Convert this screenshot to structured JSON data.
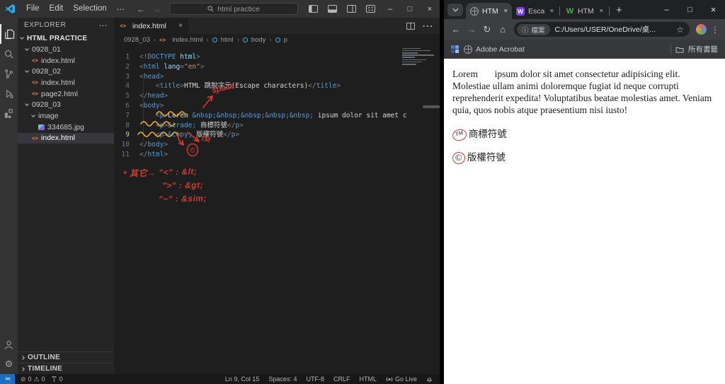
{
  "vscode": {
    "titlebar": {
      "menus": [
        "File",
        "Edit",
        "Selection",
        "⋯"
      ],
      "search_label": "html practice"
    },
    "explorer": {
      "header": "EXPLORER",
      "root": "HTML PRACTICE",
      "items": [
        {
          "label": "0928_01",
          "indent": 1,
          "chevron": true
        },
        {
          "label": "index.html",
          "indent": 2,
          "icon": "html"
        },
        {
          "label": "0928_02",
          "indent": 1,
          "chevron": true
        },
        {
          "label": "index.html",
          "indent": 2,
          "icon": "html"
        },
        {
          "label": "page2.html",
          "indent": 2,
          "icon": "html"
        },
        {
          "label": "0928_03",
          "indent": 1,
          "chevron": true
        },
        {
          "label": "image",
          "indent": 2,
          "chevron": true
        },
        {
          "label": "334685.jpg",
          "indent": 3,
          "icon": "img"
        },
        {
          "label": "index.html",
          "indent": 2,
          "icon": "html",
          "selected": true
        }
      ],
      "panels": [
        "OUTLINE",
        "TIMELINE"
      ]
    },
    "editor": {
      "tab": "index.html",
      "breadcrumb": [
        "0928_03",
        "index.html",
        "html",
        "body",
        "p"
      ],
      "lines": [
        {
          "n": 1,
          "tokens": [
            [
              "p",
              "<!"
            ],
            [
              "k",
              "DOCTYPE"
            ],
            [
              "a",
              " html"
            ],
            [
              "p",
              ">"
            ]
          ]
        },
        {
          "n": 2,
          "tokens": [
            [
              "p",
              "<"
            ],
            [
              "k",
              "html"
            ],
            [
              "a",
              " lang"
            ],
            [
              "p",
              "="
            ],
            [
              "s",
              "\"en\""
            ],
            [
              "p",
              ">"
            ]
          ]
        },
        {
          "n": 3,
          "tokens": [
            [
              "p",
              "<"
            ],
            [
              "k",
              "head"
            ],
            [
              "p",
              ">"
            ]
          ]
        },
        {
          "n": 4,
          "tokens": [
            [
              "x",
              "    "
            ],
            [
              "p",
              "<"
            ],
            [
              "k",
              "title"
            ],
            [
              "p",
              ">"
            ],
            [
              "x",
              "HTML 跳脫字元(Escape characters)"
            ],
            [
              "p",
              "</"
            ],
            [
              "k",
              "title"
            ],
            [
              "p",
              ">"
            ]
          ]
        },
        {
          "n": 5,
          "tokens": [
            [
              "p",
              "</"
            ],
            [
              "k",
              "head"
            ],
            [
              "p",
              ">"
            ]
          ]
        },
        {
          "n": 6,
          "tokens": [
            [
              "p",
              "<"
            ],
            [
              "k",
              "body"
            ],
            [
              "p",
              ">"
            ]
          ]
        },
        {
          "n": 7,
          "tokens": [
            [
              "x",
              "    "
            ],
            [
              "p",
              "<"
            ],
            [
              "k",
              "p"
            ],
            [
              "p",
              ">"
            ],
            [
              "x",
              "Lorem "
            ],
            [
              "e",
              "&nbsp;&nbsp;&nbsp;&nbsp;&nbsp;"
            ],
            [
              "x",
              " ipsum dolor sit amet c"
            ]
          ]
        },
        {
          "n": 8,
          "tokens": [
            [
              "x",
              "    "
            ],
            [
              "p",
              "<"
            ],
            [
              "k",
              "p"
            ],
            [
              "p",
              ">"
            ],
            [
              "e",
              "&trade;"
            ],
            [
              "x",
              " 商標符號"
            ],
            [
              "p",
              "</"
            ],
            [
              "k",
              "p"
            ],
            [
              "p",
              ">"
            ]
          ]
        },
        {
          "n": 9,
          "cur": true,
          "tokens": [
            [
              "x",
              "    "
            ],
            [
              "p",
              "<"
            ],
            [
              "k",
              "p"
            ],
            [
              "p",
              ">"
            ],
            [
              "e",
              "&copy;"
            ],
            [
              "x",
              " 版權符號"
            ],
            [
              "p",
              "</"
            ],
            [
              "k",
              "p"
            ],
            [
              "p",
              ">"
            ]
          ]
        },
        {
          "n": 10,
          "tokens": [
            [
              "p",
              "</"
            ],
            [
              "k",
              "body"
            ],
            [
              "p",
              ">"
            ]
          ]
        },
        {
          "n": 11,
          "tokens": [
            [
              "p",
              "</"
            ],
            [
              "k",
              "html"
            ],
            [
              "p",
              ">"
            ]
          ]
        }
      ]
    },
    "annotations": {
      "space_label": "space",
      "tm_label": "TM",
      "copyright_symbol": "©",
      "notes": [
        "* 其它→ \"<\" : &lt;",
        "\">\" : &gt;",
        "\"~\" : &sim;"
      ]
    },
    "statusbar": {
      "remote": "><",
      "errors": "0",
      "warnings": "0",
      "ports": "0",
      "cursor": "Ln 9, Col 15",
      "indent": "Spaces: 4",
      "encoding": "UTF-8",
      "eol": "CRLF",
      "language": "HTML",
      "golive": "Go Live"
    },
    "colors": {
      "accent_blue": "#1b6fc2",
      "annotation_red": "#cf3b2f",
      "annotation_yellow": "#d9a43c"
    }
  },
  "browser": {
    "tabs": [
      {
        "label": "HTM",
        "favicon": "globe",
        "active": true
      },
      {
        "label": "Esca",
        "favicon": "w-purple",
        "active": false
      },
      {
        "label": "HTM",
        "favicon": "w-green",
        "active": false
      }
    ],
    "new_tab_label": "+",
    "toolbar": {
      "info_icon": "ⓘ",
      "site_chip": "檔案",
      "url": "C:/Users/USER/OneDrive/桌...",
      "star": "☆"
    },
    "bookmarks_bar": {
      "bookmark": "Adobe Acrobat",
      "all_bookmarks": "所有書籤"
    },
    "page": {
      "paragraph": "Lorem       ipsum dolor sit amet consectetur adipisicing elit. Molestiae ullam animi doloremque fugiat id neque corrupti reprehenderit expedita! Voluptatibus beatae molestias amet. Veniam quia, quos nobis atque praesentium nisi iusto!",
      "trademark_symbol": "™",
      "trademark_label": "商標符號",
      "copyright_symbol": "©",
      "copyright_label": "版權符號"
    },
    "window_controls": {
      "minimize": "–",
      "maximize": "□",
      "close": "×"
    }
  }
}
